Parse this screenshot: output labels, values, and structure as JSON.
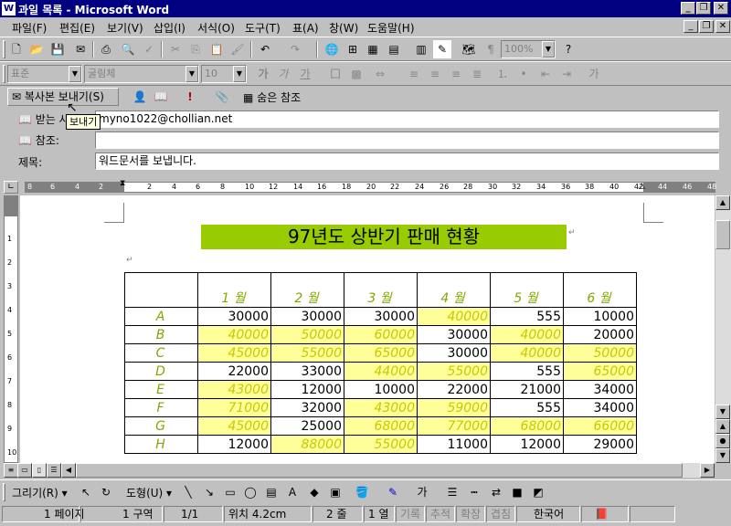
{
  "window": {
    "title": "과일 목록 - Microsoft Word"
  },
  "menubar": {
    "items": [
      "파일(F)",
      "편집(E)",
      "보기(V)",
      "삽입(I)",
      "서식(O)",
      "도구(T)",
      "표(A)",
      "창(W)",
      "도움말(H)"
    ]
  },
  "toolbar2": {
    "style": "표준",
    "font": "굴림체",
    "size": "10",
    "zoom": "100%"
  },
  "mail": {
    "send_copy": "복사본 보내기(S)",
    "hidden_ref": "숨은 참조",
    "to_label": "받는 사람:",
    "to_value": "myno1022@chollian.net",
    "cc_label": "참조:",
    "cc_value": "",
    "subject_label": "제목:",
    "subject_value": "워드문서를 보냅니다.",
    "tooltip": "보내기"
  },
  "ruler": {
    "ticks": [
      "8",
      "6",
      "4",
      "2",
      "2",
      "4",
      "6",
      "8",
      "10",
      "12",
      "14",
      "16",
      "18",
      "20",
      "22",
      "24",
      "26",
      "28",
      "30",
      "32",
      "34",
      "36",
      "38",
      "40",
      "42",
      "44",
      "46",
      "48"
    ]
  },
  "vruler": {
    "ticks": [
      "1",
      "2",
      "3",
      "4",
      "5",
      "6",
      "7",
      "8",
      "9",
      "10"
    ]
  },
  "document": {
    "title": "97년도 상반기 판매 현황",
    "table": {
      "headers": [
        "",
        "1 월",
        "2 월",
        "3 월",
        "4 월",
        "5 월",
        "6 월"
      ],
      "rows": [
        {
          "label": "A",
          "values": [
            "30000",
            "30000",
            "30000",
            "40000",
            "555",
            "10000"
          ],
          "highlight": [
            false,
            false,
            false,
            true,
            false,
            false
          ]
        },
        {
          "label": "B",
          "values": [
            "40000",
            "50000",
            "60000",
            "30000",
            "40000",
            "20000"
          ],
          "highlight": [
            true,
            true,
            true,
            false,
            true,
            false
          ]
        },
        {
          "label": "C",
          "values": [
            "45000",
            "55000",
            "65000",
            "30000",
            "40000",
            "50000"
          ],
          "highlight": [
            true,
            true,
            true,
            false,
            true,
            true
          ]
        },
        {
          "label": "D",
          "values": [
            "22000",
            "33000",
            "44000",
            "55000",
            "555",
            "65000"
          ],
          "highlight": [
            false,
            false,
            true,
            true,
            false,
            true
          ]
        },
        {
          "label": "E",
          "values": [
            "43000",
            "12000",
            "10000",
            "22000",
            "21000",
            "34000"
          ],
          "highlight": [
            true,
            false,
            false,
            false,
            false,
            false
          ]
        },
        {
          "label": "F",
          "values": [
            "71000",
            "32000",
            "43000",
            "59000",
            "555",
            "34000"
          ],
          "highlight": [
            true,
            false,
            true,
            true,
            false,
            false
          ]
        },
        {
          "label": "G",
          "values": [
            "45000",
            "25000",
            "68000",
            "77000",
            "68000",
            "66000"
          ],
          "highlight": [
            true,
            false,
            true,
            true,
            true,
            true
          ]
        },
        {
          "label": "H",
          "values": [
            "12000",
            "88000",
            "55000",
            "11000",
            "12000",
            "29000"
          ],
          "highlight": [
            false,
            true,
            true,
            false,
            false,
            false
          ]
        }
      ]
    }
  },
  "drawbar": {
    "draw": "그리기(R)",
    "autoshape": "도형(U)"
  },
  "status": {
    "page": "1 페이지",
    "section": "1 구역",
    "pages": "1/1",
    "position": "위치 4.2cm",
    "line": "2 줄",
    "column": "1 열",
    "rec": "기록",
    "trk": "추적",
    "ext": "확장",
    "ovr": "겹침",
    "lang": "한국어"
  },
  "colors": {
    "titlebar": "#000080",
    "title_highlight": "#99cc00",
    "cell_highlight": "#ffff99",
    "italic_text": "#80a800"
  }
}
